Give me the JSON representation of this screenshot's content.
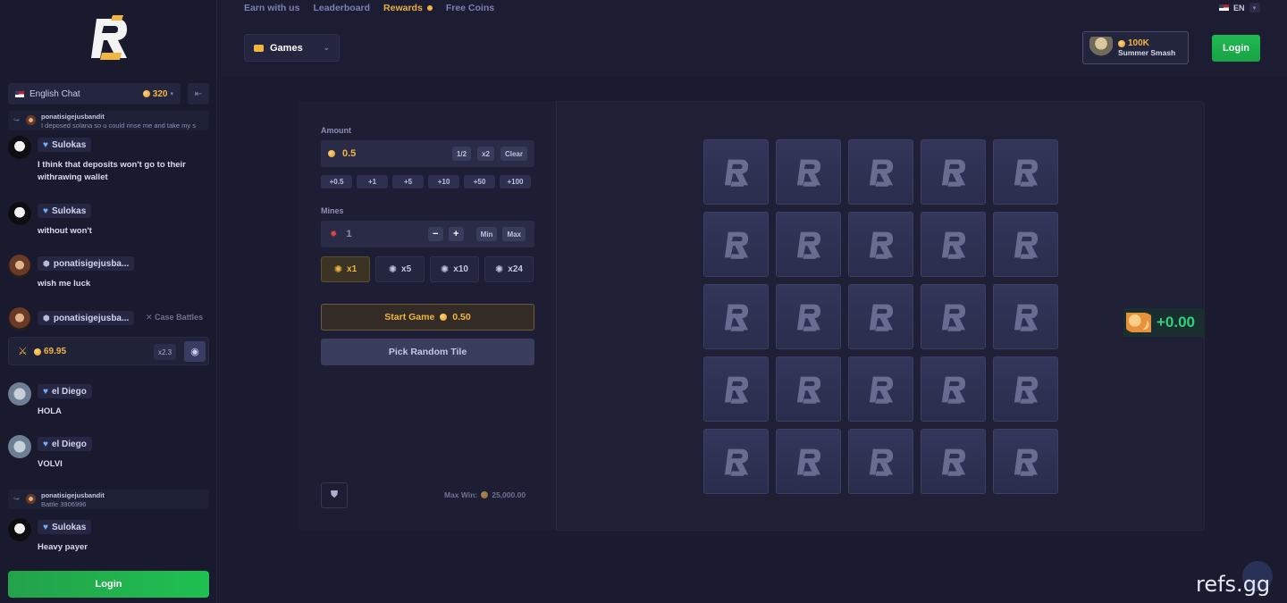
{
  "nav": {
    "earn": "Earn with us",
    "leaderboard": "Leaderboard",
    "rewards": "Rewards",
    "free_coins": "Free Coins",
    "lang": "EN"
  },
  "games_menu": "Games",
  "promo": {
    "amount": "100K",
    "name": "Summer Smash"
  },
  "login": "Login",
  "chat": {
    "room": "English Chat",
    "online": "320",
    "messages": [
      {
        "type": "reply",
        "user": "ponatisigejusbandit",
        "text": "I deposed solana so u could rinse me and take my s"
      },
      {
        "type": "msg",
        "user": "Sulokas",
        "text": "I think that deposits won't go to their withrawing wallet"
      },
      {
        "type": "msg",
        "user": "Sulokas",
        "text": "without won't"
      },
      {
        "type": "msg",
        "user": "ponatisigejusba...",
        "text": "wish me luck"
      },
      {
        "type": "msg",
        "user": "ponatisigejusba...",
        "text": ""
      },
      {
        "type": "msg",
        "user": "el Diego",
        "text": "HOLA"
      },
      {
        "type": "msg",
        "user": "el Diego",
        "text": "VOLVI"
      },
      {
        "type": "reply",
        "user": "ponatisigejusbandit",
        "text": "Battle 3906996"
      },
      {
        "type": "msg",
        "user": "Sulokas",
        "text": "Heavy payer"
      }
    ],
    "case_battles_label": "Case Battles",
    "battle_amount": "69.95",
    "battle_mult": "x2.3"
  },
  "game": {
    "amount_label": "Amount",
    "amount_value": "0.5",
    "half": "1/2",
    "double": "x2",
    "clear": "Clear",
    "quick": [
      "+0.5",
      "+1",
      "+5",
      "+10",
      "+50",
      "+100"
    ],
    "mines_label": "Mines",
    "mines_value": "1",
    "minus": "−",
    "plus": "+",
    "min": "Min",
    "max": "Max",
    "presets": [
      "x1",
      "x5",
      "x10",
      "x24"
    ],
    "start_label": "Start Game",
    "start_amount": "0.50",
    "random_label": "Pick Random Tile",
    "max_win_label": "Max Win:",
    "max_win_value": "25,000.00",
    "profit": "+0.00"
  },
  "watermark": "refs.gg",
  "colors": {
    "accent": "#f2b540",
    "green": "#1fc052",
    "bg": "#1c1d32"
  }
}
